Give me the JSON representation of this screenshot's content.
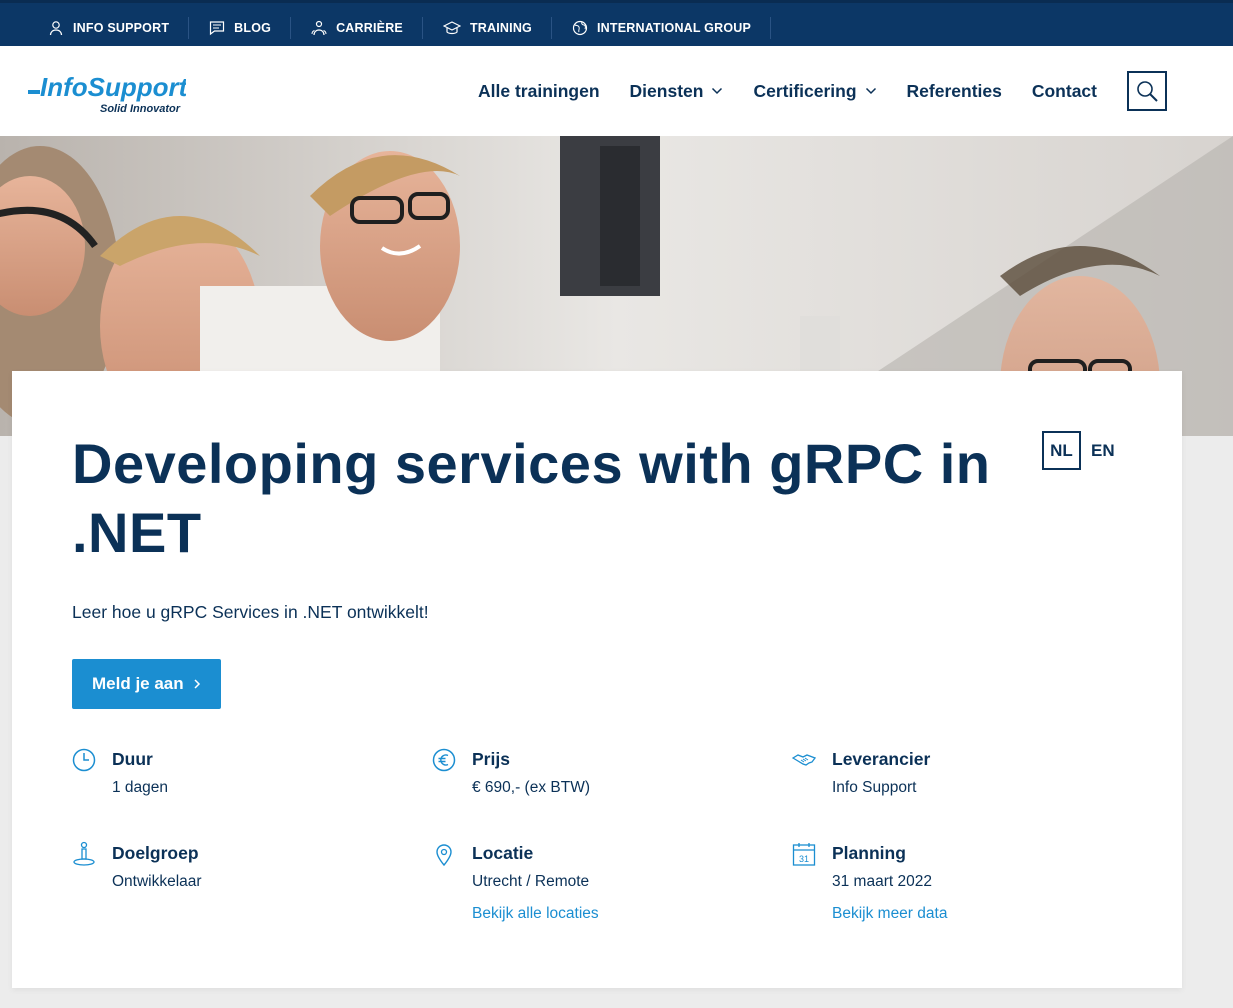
{
  "topbar": {
    "items": [
      {
        "label": "INFO SUPPORT",
        "icon": "person-icon"
      },
      {
        "label": "BLOG",
        "icon": "chat-icon"
      },
      {
        "label": "CARRIÈRE",
        "icon": "people-icon"
      },
      {
        "label": "TRAINING",
        "icon": "graduation-cap-icon"
      },
      {
        "label": "INTERNATIONAL GROUP",
        "icon": "globe-icon"
      }
    ]
  },
  "header": {
    "logo_text": "InfoSupport",
    "logo_tagline": "Solid Innovator",
    "nav": [
      {
        "label": "Alle trainingen",
        "dropdown": false
      },
      {
        "label": "Diensten",
        "dropdown": true
      },
      {
        "label": "Certificering",
        "dropdown": true
      },
      {
        "label": "Referenties",
        "dropdown": false
      },
      {
        "label": "Contact",
        "dropdown": false
      }
    ],
    "search_icon": "search-icon"
  },
  "course": {
    "title": "Developing services with gRPC in .NET",
    "subtitle": "Leer hoe u gRPC Services in .NET ontwikkelt!",
    "cta_label": "Meld je aan",
    "languages": {
      "active": "NL",
      "other": "EN"
    }
  },
  "facts": [
    {
      "label": "Duur",
      "value": "1 dagen",
      "link": "",
      "icon": "clock-icon"
    },
    {
      "label": "Prijs",
      "value": "€ 690,- (ex BTW)",
      "link": "",
      "icon": "euro-icon"
    },
    {
      "label": "Leverancier",
      "value": "Info Support",
      "link": "",
      "icon": "handshake-icon"
    },
    {
      "label": "Doelgroep",
      "value": "Ontwikkelaar",
      "link": "",
      "icon": "target-group-icon"
    },
    {
      "label": "Locatie",
      "value": "Utrecht / Remote",
      "link": "Bekijk alle locaties",
      "icon": "location-pin-icon"
    },
    {
      "label": "Planning",
      "value": "31 maart 2022",
      "link": "Bekijk meer data",
      "icon": "calendar-icon"
    }
  ],
  "colors": {
    "navy": "#0b3157",
    "topbar": "#0c3766",
    "accent_blue": "#1b8ed1"
  }
}
